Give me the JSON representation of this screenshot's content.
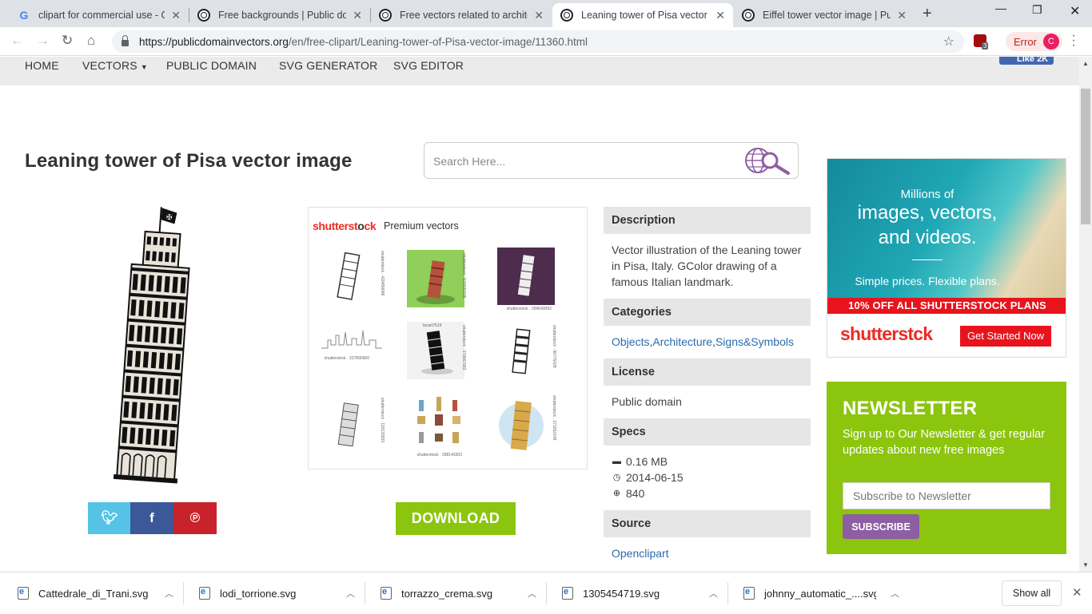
{
  "browser": {
    "tabs": [
      {
        "title": "clipart for commercial use - Go",
        "favicon": "google-icon"
      },
      {
        "title": "Free backgrounds | Public dom",
        "favicon": "publicdomainvectors-icon"
      },
      {
        "title": "Free vectors related to architec",
        "favicon": "publicdomainvectors-icon"
      },
      {
        "title": "Leaning tower of Pisa vector im",
        "favicon": "publicdomainvectors-icon",
        "active": true
      },
      {
        "title": "Eiffel tower vector image | Pub",
        "favicon": "publicdomainvectors-icon"
      }
    ],
    "url_host": "https://publicdomainvectors.org",
    "url_path": "/en/free-clipart/Leaning-tower-of-Pisa-vector-image/11360.html",
    "extension_badge": "3",
    "profile_status": "Error",
    "profile_initial": "C"
  },
  "site": {
    "nav": [
      "HOME",
      "VECTORS",
      "PUBLIC DOMAIN",
      "SVG GENERATOR",
      "SVG EDITOR"
    ],
    "fb_like": "Like 2K",
    "page_title": "Leaning tower of Pisa vector image",
    "search_placeholder": "Search Here...",
    "premium": {
      "logo_red": "shutterst",
      "logo_dark": "o",
      "logo_red2": "ck",
      "label": "Premium vectors",
      "captions": [
        "shutterstock · 429458086",
        "shutterstock · 529030935",
        "shutterstock · 299643092",
        "shutterstock · 227890960",
        "shutterstock · 379667993",
        "shutterstock · 96776428",
        "shutterstock · 115133933",
        "shutterstock · 298143303",
        "shutterstock · 273262148"
      ],
      "top_caption": "lecart7519"
    },
    "download_label": "DOWNLOAD",
    "info": {
      "description_hdr": "Description",
      "description": "Vector illustration of the Leaning tower in Pisa, Italy. GColor drawing of a famous Italian landmark.",
      "categories_hdr": "Categories",
      "categories": [
        "Objects",
        "Architecture",
        "Signs&Symbols"
      ],
      "license_hdr": "License",
      "license": "Public domain",
      "specs_hdr": "Specs",
      "size": "0.16 MB",
      "date": "2014-06-15",
      "downloads": "840",
      "source_hdr": "Source",
      "source": "Openclipart"
    },
    "ad": {
      "line1": "Millions of",
      "line2": "images, vectors,",
      "line3": "and videos.",
      "line4": "Simple prices. Flexible plans.",
      "offer": "10% OFF ALL SHUTTERSTOCK PLANS",
      "logo": "shutterstck",
      "cta": "Get Started Now"
    },
    "newsletter": {
      "title": "NEWSLETTER",
      "text": "Sign up to Our Newsletter & get regular updates about new free images",
      "placeholder": "Subscribe to Newsletter",
      "button": "SUBSCRIBE"
    }
  },
  "downloads": {
    "items": [
      "Cattedrale_di_Trani.svg",
      "lodi_torrione.svg",
      "torrazzo_crema.svg",
      "1305454719.svg",
      "johnny_automatic_....svg"
    ],
    "show_all": "Show all"
  }
}
